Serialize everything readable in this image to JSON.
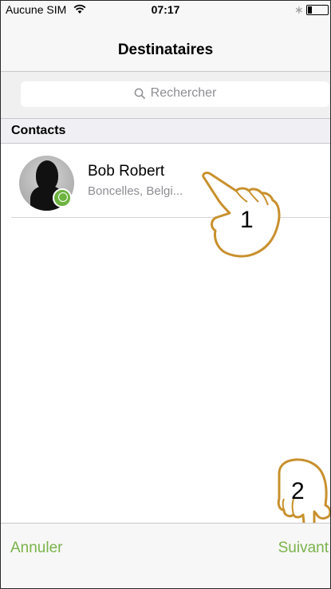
{
  "status_bar": {
    "carrier": "Aucune SIM",
    "time": "07:17",
    "wifi_icon": "wifi-icon",
    "bluetooth_icon": "bluetooth-icon",
    "battery_icon": "battery-icon"
  },
  "nav": {
    "title": "Destinataires"
  },
  "search": {
    "placeholder": "Rechercher",
    "icon": "search-icon"
  },
  "section": {
    "title": "Contacts"
  },
  "contacts": [
    {
      "name": "Bob Robert",
      "location": "Boncelles, Belgi...",
      "badge_icon": "contact-badge-icon"
    }
  ],
  "annotations": {
    "step_1": "1",
    "step_2": "2"
  },
  "toolbar": {
    "cancel_label": "Annuler",
    "next_label": "Suivant"
  },
  "colors": {
    "accent": "#7ab34a",
    "badge": "#6cb33f",
    "hand_fill": "#ffffff",
    "hand_outline": "#c8902d"
  }
}
